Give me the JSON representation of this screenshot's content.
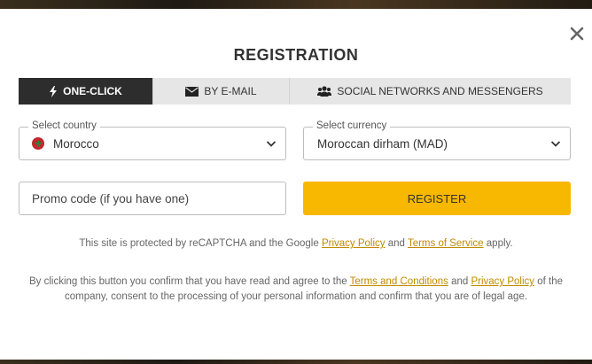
{
  "modal": {
    "title": "REGISTRATION"
  },
  "tabs": [
    {
      "label": "ONE-CLICK",
      "icon": "lightning-icon",
      "active": true
    },
    {
      "label": "BY E-MAIL",
      "icon": "envelope-icon",
      "active": false
    },
    {
      "label": "SOCIAL NETWORKS AND MESSENGERS",
      "icon": "users-icon",
      "active": false
    }
  ],
  "country": {
    "label": "Select country",
    "value": "Morocco",
    "flag_color": "#c1272d"
  },
  "currency": {
    "label": "Select currency",
    "value": "Moroccan dirham (MAD)"
  },
  "promo": {
    "placeholder": "Promo code (if you have one)"
  },
  "register": {
    "label": "REGISTER",
    "color": "#f8b700"
  },
  "recaptcha": {
    "prefix": "This site is protected by reCAPTCHA and the Google",
    "privacy_link": "Privacy Policy",
    "and": "and",
    "terms_link": "Terms of Service",
    "suffix": "apply."
  },
  "legal": {
    "prefix": "By clicking this button you confirm that you have read and agree to the",
    "terms_link": "Terms and Conditions",
    "and": "and",
    "privacy_link": "Privacy Policy",
    "suffix": "of the company, consent to the processing of your personal information and confirm that you are of legal age."
  },
  "colors": {
    "accent": "#f8b700",
    "link": "#c08a00",
    "active_tab": "#2d2d2d"
  }
}
